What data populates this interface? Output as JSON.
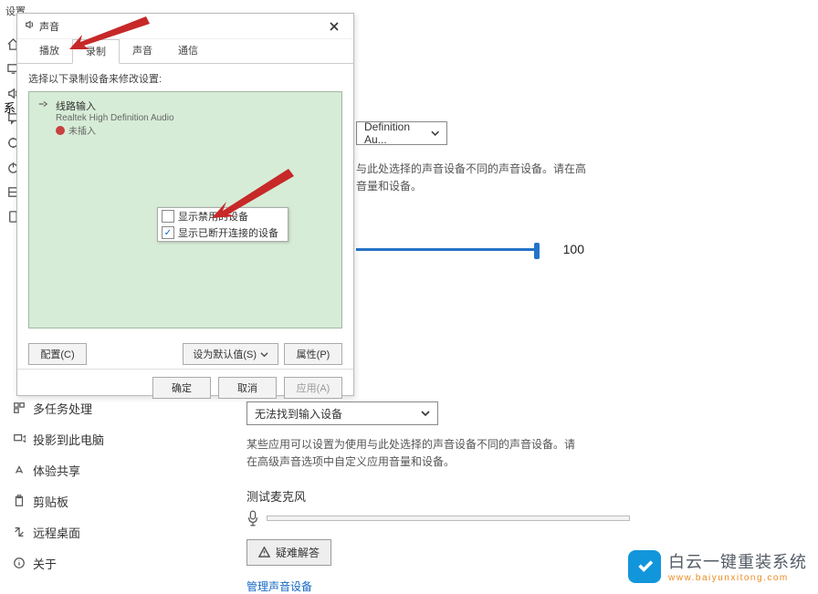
{
  "settings_header": "设置",
  "sidebar_sys": "系",
  "sidebar": {
    "items": [
      {
        "label": "多任务处理"
      },
      {
        "label": "投影到此电脑"
      },
      {
        "label": "体验共享"
      },
      {
        "label": "剪贴板"
      },
      {
        "label": "远程桌面"
      },
      {
        "label": "关于"
      }
    ]
  },
  "right": {
    "combo1_text": "Definition Au...",
    "desc1a": "与此处选择的声音设备不同的声音设备。请在高",
    "desc1b": "音量和设备。",
    "slider_value": "100",
    "combo2_text": "无法找到输入设备",
    "desc2": "某些应用可以设置为使用与此处选择的声音设备不同的声音设备。请在高级声音选项中自定义应用音量和设备。",
    "mic_label": "测试麦克风",
    "trouble_label": "疑难解答",
    "link_label": "管理声音设备"
  },
  "dialog": {
    "title": "声音",
    "tabs": [
      "播放",
      "录制",
      "声音",
      "通信"
    ],
    "active_tab": 1,
    "instruction": "选择以下录制设备来修改设置:",
    "device": {
      "name": "线路输入",
      "driver": "Realtek High Definition Audio",
      "status": "未插入"
    },
    "context_menu": {
      "item1": "显示禁用的设备",
      "item2": "显示已断开连接的设备"
    },
    "buttons": {
      "configure": "配置(C)",
      "set_default": "设为默认值(S)",
      "properties": "属性(P)",
      "ok": "确定",
      "cancel": "取消",
      "apply": "应用(A)"
    }
  },
  "watermark": {
    "brand": "白云一键重装系统",
    "url": "www.baiyunxitong.com"
  }
}
